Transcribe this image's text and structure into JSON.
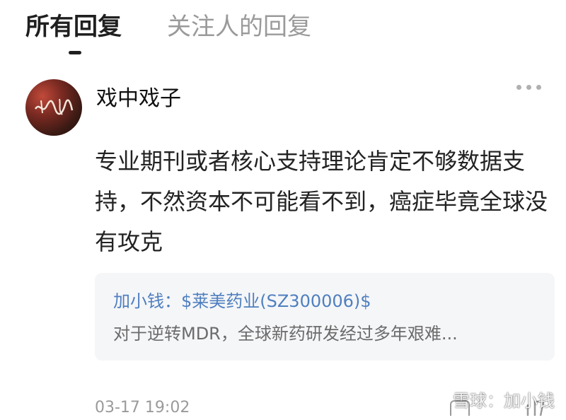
{
  "tabs": [
    {
      "label": "所有回复",
      "active": true
    },
    {
      "label": "关注人的回复",
      "active": false
    }
  ],
  "reply": {
    "username": "戏中戏子",
    "avatar_icon": "calligraphy-avatar",
    "more_icon": "more-dots-icon",
    "content": "专业期刊或者核心支持理论肯定不够数据支持，不然资本不可能看不到，癌症毕竟全球没有攻克",
    "quote": {
      "author_prefix": "加小钱：",
      "stock_link": "$莱美药业(SZ300006)$",
      "excerpt": "对于逆转MDR，全球新药研发经过多年艰难..."
    },
    "timestamp": "03-17 19:02"
  },
  "watermark": {
    "text": "雪球：加小钱",
    "icon": "xueqiu-logo-icon"
  },
  "colors": {
    "link": "#4f7fbf",
    "quote_bg": "#f5f6f8",
    "muted": "#9a9a9a"
  }
}
